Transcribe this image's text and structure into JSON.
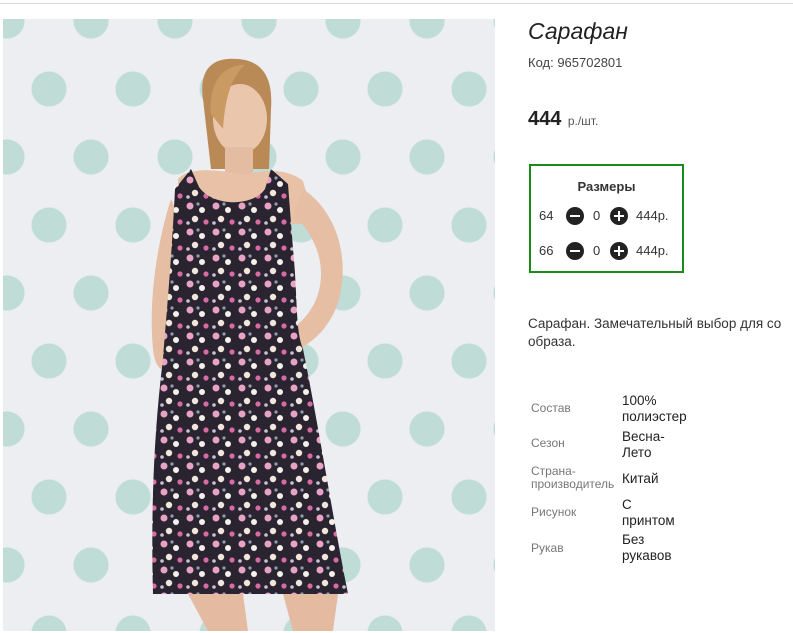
{
  "product": {
    "title": "Сарафан",
    "code": "Код: 965702801",
    "price": "444",
    "price_unit": "р./шт.",
    "description": "Сарафан. Замечательный выбор для со\nобраза."
  },
  "sizes": {
    "title": "Размеры",
    "rows": [
      {
        "size": "64",
        "qty": "0",
        "price": "444р."
      },
      {
        "size": "66",
        "qty": "0",
        "price": "444р."
      }
    ]
  },
  "specs": [
    {
      "label": "Состав",
      "value": "100%\nполиэстер"
    },
    {
      "label": "Сезон",
      "value": "Весна-\nЛето"
    },
    {
      "label": "Страна-\nпроизводитель",
      "value": "Китай"
    },
    {
      "label": "Рисунок",
      "value": "С\nпринтом"
    },
    {
      "label": "Рукав",
      "value": "Без\nрукавов"
    }
  ],
  "colors": {
    "border_green": "#1a8a1a",
    "dot_color": "#bfdcd7",
    "dress_base": "#2a2430"
  }
}
